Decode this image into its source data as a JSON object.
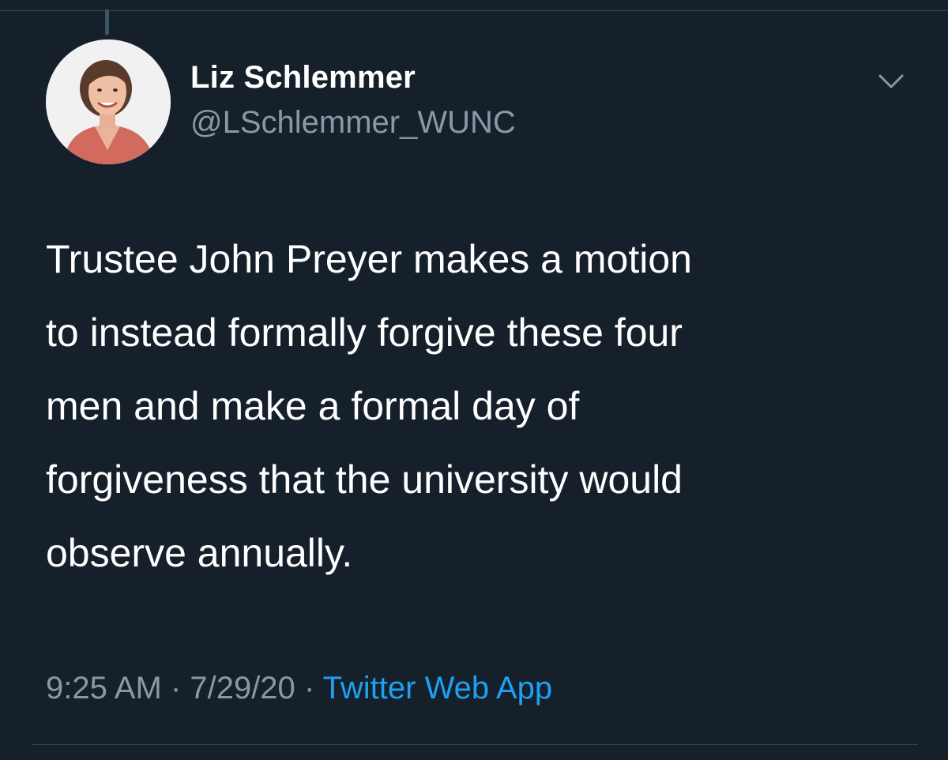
{
  "tweet": {
    "author_name": "Liz Schlemmer",
    "author_handle": "@LSchlemmer_WUNC",
    "avatar_icon": "profile-photo",
    "menu_icon": "chevron-down-icon",
    "text_lines": [
      "Trustee John Preyer makes a motion",
      "to instead formally forgive these four",
      "men and make a formal day of",
      "forgiveness that the university would",
      "observe annually."
    ],
    "time": "9:25 AM",
    "separator": "·",
    "date": "7/29/20",
    "source": "Twitter Web App"
  },
  "colors": {
    "background": "#15202b",
    "primary_text": "#ffffff",
    "secondary_text": "#8899a6",
    "link": "#1da1f2",
    "divider": "#38444d"
  }
}
